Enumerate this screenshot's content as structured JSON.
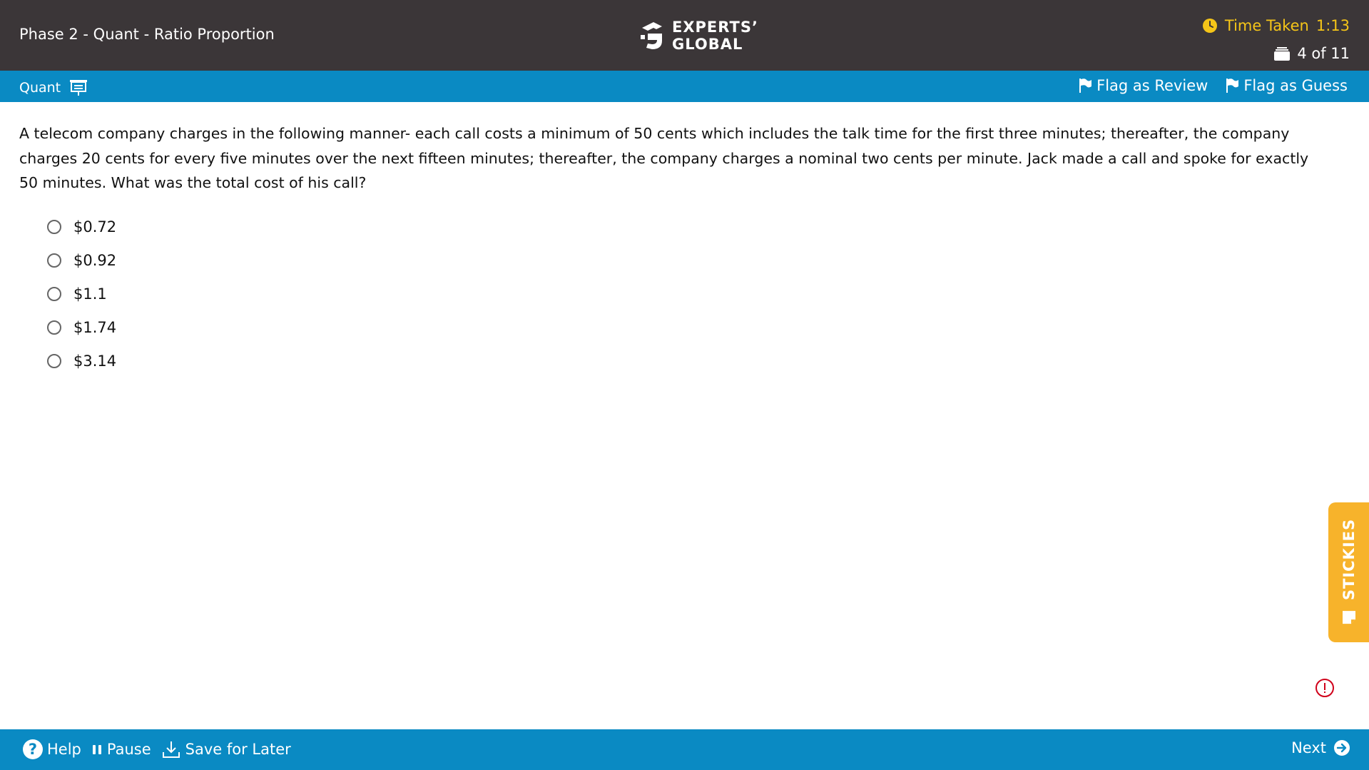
{
  "header": {
    "title": "Phase 2 - Quant - Ratio Proportion",
    "logo_line1": "EXPERTS’",
    "logo_line2": "GLOBAL",
    "timer_label": "Time Taken",
    "timer_value": "1:13",
    "counter": "4 of 11",
    "timer_color": "#f5c518"
  },
  "subbar": {
    "section": "Quant",
    "flag_review": "Flag as Review",
    "flag_guess": "Flag as Guess"
  },
  "question": {
    "text": "A telecom company charges in the following manner- each call costs a minimum of 50 cents which includes the talk time for the first three minutes; thereafter, the company charges 20 cents for every five minutes over the next fifteen minutes; thereafter, the company charges a nominal two cents per minute. Jack made a call and spoke for exactly 50 minutes. What was the total cost of his call?",
    "options": [
      "$0.72",
      "$0.92",
      "$1.1",
      "$1.74",
      "$3.14"
    ]
  },
  "stickies": {
    "label": "STICKIES"
  },
  "footer": {
    "help": "Help",
    "pause": "Pause",
    "save": "Save for Later",
    "next": "Next"
  },
  "colors": {
    "header_bg": "#3b3638",
    "bar_blue": "#0a8ac3",
    "stickies": "#f7b32b",
    "alert": "#d0021b"
  }
}
